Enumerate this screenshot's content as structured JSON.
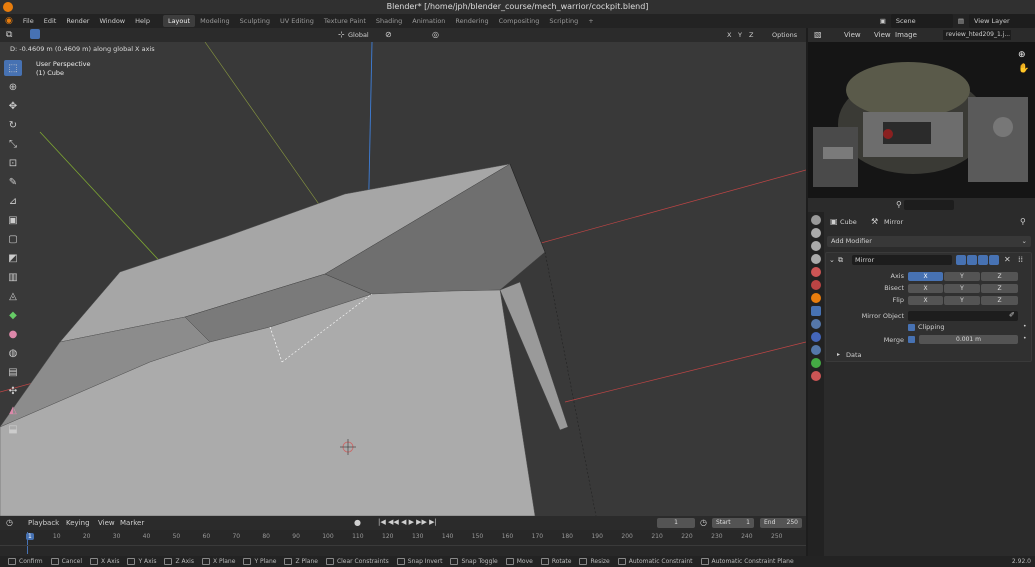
{
  "window": {
    "title": "Blender* [/home/jph/blender_course/mech_warrior/cockpit.blend]"
  },
  "menu": {
    "items": [
      "File",
      "Edit",
      "Render",
      "Window",
      "Help"
    ]
  },
  "workspaces": [
    "Layout",
    "Modeling",
    "Sculpting",
    "UV Editing",
    "Texture Paint",
    "Shading",
    "Animation",
    "Rendering",
    "Compositing",
    "Scripting"
  ],
  "topbar": {
    "scene": "Scene",
    "view_layer": "View Layer"
  },
  "viewport": {
    "orientation": "Global",
    "options": "Options",
    "axes": [
      "X",
      "Y",
      "Z"
    ],
    "status": "D: -0.4609 m (0.4609 m) along global X axis",
    "view_name": "User Perspective",
    "object_name": "(1) Cube"
  },
  "image_editor": {
    "view": "View",
    "view2": "View",
    "image": "Image",
    "filename": "review_hted209_1.j..."
  },
  "properties": {
    "object": "Cube",
    "modifier_tab": "Mirror",
    "add_modifier": "Add Modifier",
    "modifier_name": "Mirror",
    "rows": [
      {
        "label": "Axis"
      },
      {
        "label": "Bisect"
      },
      {
        "label": "Flip"
      }
    ],
    "xyz": [
      "X",
      "Y",
      "Z"
    ],
    "mirror_object": "Mirror Object",
    "clipping": "Clipping",
    "merge": "Merge",
    "merge_value": "0.001 m",
    "data": "Data"
  },
  "timeline": {
    "menus": [
      "Playback",
      "Keying",
      "View",
      "Marker"
    ],
    "current_frame": "1",
    "start_label": "Start",
    "start": "1",
    "end_label": "End",
    "end": "250",
    "ticks": [
      "1",
      "10",
      "20",
      "30",
      "40",
      "50",
      "60",
      "70",
      "80",
      "90",
      "100",
      "110",
      "120",
      "130",
      "140",
      "150",
      "160",
      "170",
      "180",
      "190",
      "200",
      "210",
      "220",
      "230",
      "240",
      "250"
    ]
  },
  "statusbar": {
    "items": [
      "Confirm",
      "Cancel",
      "X Axis",
      "Y Axis",
      "Z Axis",
      "X Plane",
      "Y Plane",
      "Z Plane",
      "Clear Constraints",
      "Snap Invert",
      "Snap Toggle",
      "Move",
      "Rotate",
      "Resize",
      "Automatic Constraint",
      "Automatic Constraint Plane"
    ],
    "version": "2.92.0"
  },
  "colors": {
    "accent": "#4772b3",
    "x_axis": "#d04848",
    "y_axis": "#8fb83a",
    "z_axis": "#3e7ed8",
    "logo": "#e87d0d"
  }
}
